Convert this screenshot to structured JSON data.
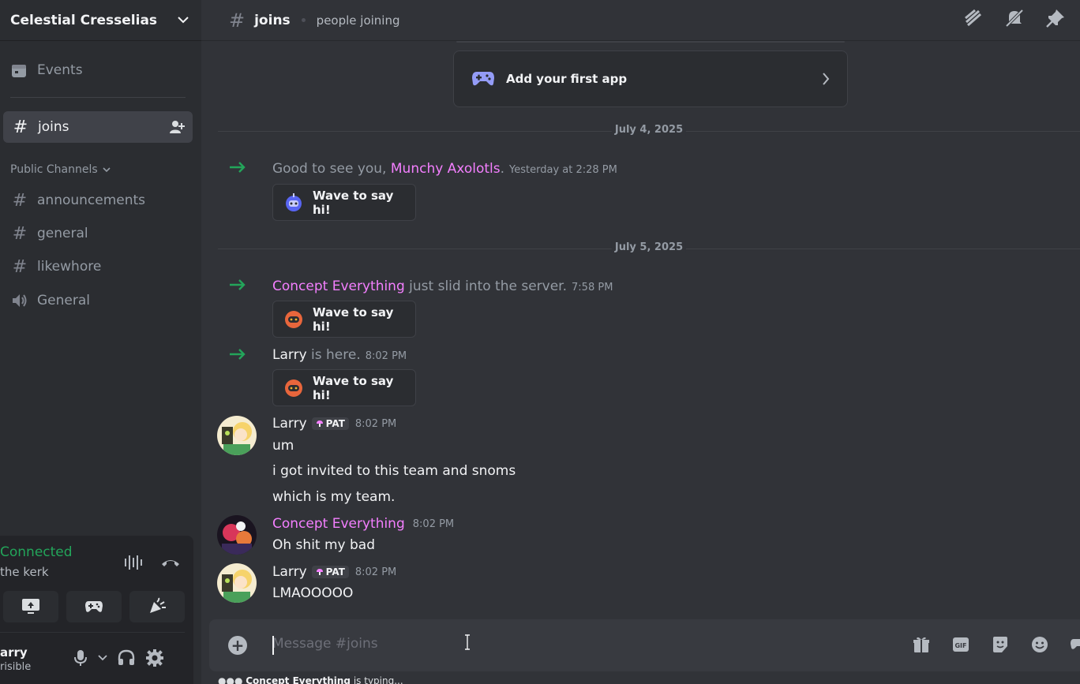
{
  "server": {
    "name": "Celestial Cresselias"
  },
  "sidebar": {
    "events_label": "Events",
    "active_channel": "joins",
    "category": "Public Channels",
    "channels": [
      "announcements",
      "general",
      "likewhore"
    ],
    "voice_channel": "General"
  },
  "voice": {
    "status": "Connected",
    "room": "the kerk"
  },
  "user": {
    "name": "arry",
    "status": "risible"
  },
  "header": {
    "channel": "joins",
    "topic": "people joining"
  },
  "app_card": {
    "label": "Add your first app"
  },
  "dividers": [
    "July 4, 2025",
    "July 5, 2025"
  ],
  "system_messages": [
    {
      "prefix": "Good to see you, ",
      "name": "Munchy Axolotls",
      "suffix": ".",
      "time": "Yesterday at 2:28 PM",
      "wave": "Wave to say hi!"
    },
    {
      "prefix": "",
      "name": "Concept Everything",
      "suffix": " just slid into the server.",
      "time": "7:58 PM",
      "wave": "Wave to say hi!"
    },
    {
      "prefix": "",
      "name": "Larry",
      "suffix": " is here.",
      "time": "8:02 PM",
      "wave": "Wave to say hi!"
    }
  ],
  "messages": [
    {
      "author": "Larry",
      "tag": "PAT",
      "time": "8:02 PM",
      "lines": [
        "um",
        "i got invited to this team and snoms",
        "which is my team."
      ]
    },
    {
      "author": "Concept Everything",
      "tag": "",
      "time": "8:02 PM",
      "lines": [
        "Oh shit my bad"
      ]
    },
    {
      "author": "Larry",
      "tag": "PAT",
      "time": "8:02 PM",
      "lines": [
        "LMAOOOOO"
      ]
    }
  ],
  "composer": {
    "placeholder": "Message #joins"
  },
  "typing": {
    "name": "Concept Everything",
    "suffix": " is typing..."
  },
  "colors": {
    "accent_green": "#23a55a",
    "role_pink": "#f47fff",
    "background": "#313338",
    "sidebar": "#2b2d31"
  }
}
